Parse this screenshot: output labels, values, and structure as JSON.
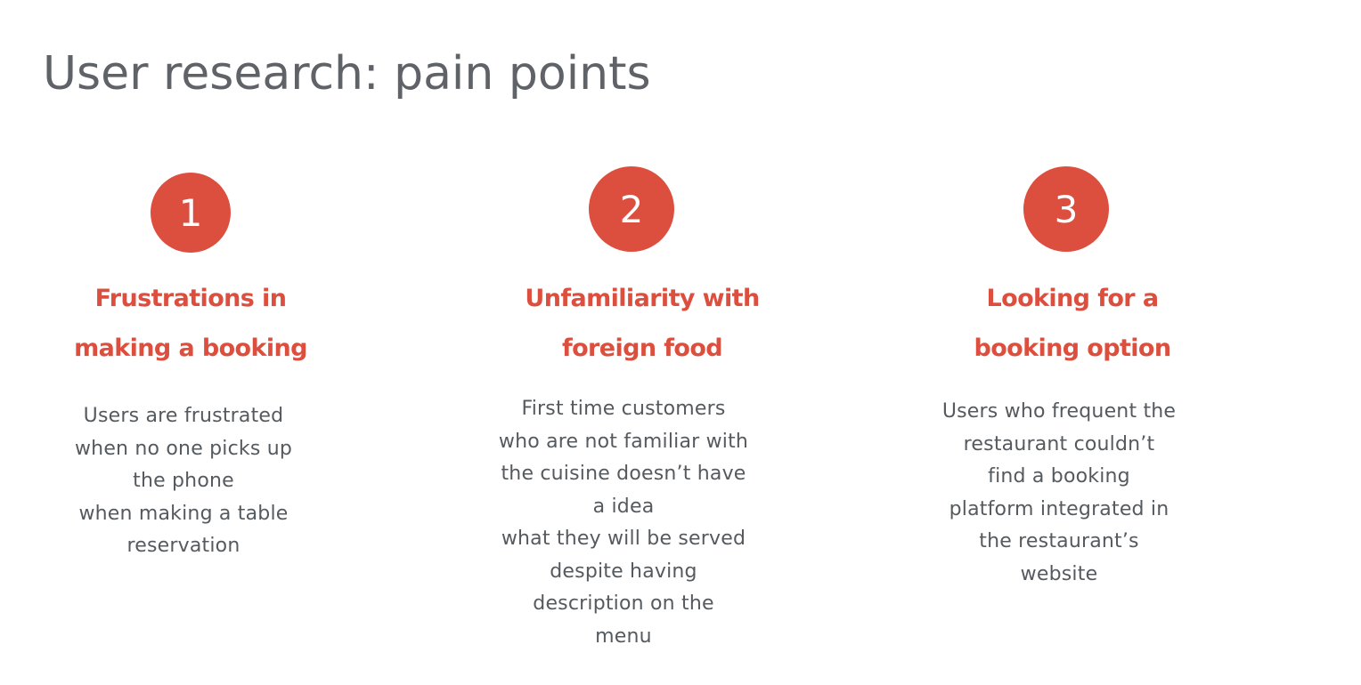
{
  "title": "User research: pain points",
  "colors": {
    "accent": "#dc4f3f",
    "title_text": "#5f6368",
    "body_text": "#555a5f"
  },
  "pain_points": [
    {
      "number": "1",
      "heading_lines": [
        "Frustrations in",
        "making a booking"
      ],
      "body_lines": [
        "Users are frustrated",
        "when no one picks up",
        "the phone",
        "when making a table",
        "reservation"
      ]
    },
    {
      "number": "2",
      "heading_lines": [
        "Unfamiliarity with",
        "foreign food"
      ],
      "body_lines": [
        "First time customers",
        "who are not familiar with",
        "the cuisine doesn’t have",
        "a idea",
        "what they will be served",
        "despite having",
        "description on the",
        "menu"
      ]
    },
    {
      "number": "3",
      "heading_lines": [
        "Looking for a",
        "booking option"
      ],
      "body_lines": [
        "Users who frequent the",
        "restaurant couldn’t",
        "find a booking",
        "platform integrated in",
        "the restaurant’s",
        "website"
      ]
    }
  ]
}
